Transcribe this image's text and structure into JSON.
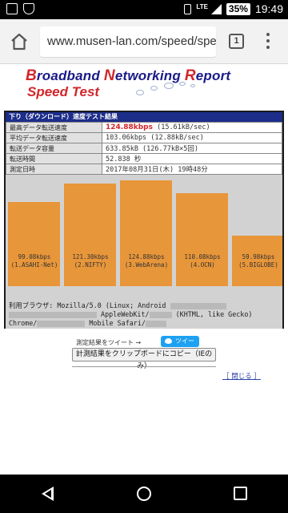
{
  "status_bar": {
    "battery": "35%",
    "network": "LTE",
    "time": "19:49"
  },
  "browser": {
    "url": "www.musen-lan.com/speed/spee",
    "tab_count": "1"
  },
  "banner": {
    "line1_parts": [
      {
        "cap": "B",
        "rest": "roadband "
      },
      {
        "cap": "N",
        "rest": "etworking "
      },
      {
        "cap": "R",
        "rest": "eport"
      }
    ],
    "line2": "Speed Test"
  },
  "panel": {
    "title": "下り（ダウンロード）速度テスト結果",
    "rows": [
      {
        "label": "最高データ転送速度",
        "value": "124.88kbps",
        "detail": " (15.61kB/sec)"
      },
      {
        "label": "平均データ転送速度",
        "value": "103.06kbps (12.88kB/sec)",
        "detail": ""
      },
      {
        "label": "転送データ容量",
        "value": "633.85kB (126.77kB×5回)",
        "detail": ""
      },
      {
        "label": "転送時間",
        "value": "52.838 秒",
        "detail": ""
      },
      {
        "label": "測定日時",
        "value": "2017年08月31日(木) 19時48分",
        "detail": ""
      }
    ]
  },
  "chart_data": {
    "type": "bar",
    "categories": [
      "1.ASAHI-Net",
      "2.NIFTY",
      "3.WebArena",
      "4.OCN",
      "5.BIGLOBE"
    ],
    "values": [
      99.08,
      121.3,
      124.88,
      110.08,
      59.98
    ],
    "labels": [
      [
        "99.08kbps",
        "(1.ASAHI-Net)"
      ],
      [
        "121.30kbps",
        "(2.NIFTY)"
      ],
      [
        "124.88kbps",
        "(3.WebArena)"
      ],
      [
        "110.08kbps",
        "(4.OCN)"
      ],
      [
        "59.98kbps",
        "(5.BIGLOBE)"
      ]
    ],
    "ylim": [
      0,
      124.88
    ],
    "bar_color": "#e8963a",
    "grid": false,
    "legend": "none"
  },
  "user_agent": {
    "line1": "利用ブラウザ: Mozilla/5.0 (Linux; Android",
    "line2a": "AppleWebKit/",
    "line2b": "(KHTML, like Gecko)",
    "line3a": "Chrome/",
    "line3b": "Mobile Safari/"
  },
  "actions": {
    "tweet_label": "測定結果をツイート →",
    "tweet_button": "ツイート",
    "copy_button": "計測結果をクリップボードにコピー（IEのみ）",
    "close_link": "［ 閉じる ］"
  },
  "colors": {
    "title_bar": "#1c2d8a",
    "accent_red": "#d2262b",
    "bar": "#e8963a",
    "panel_bg": "#d2d2d2"
  }
}
